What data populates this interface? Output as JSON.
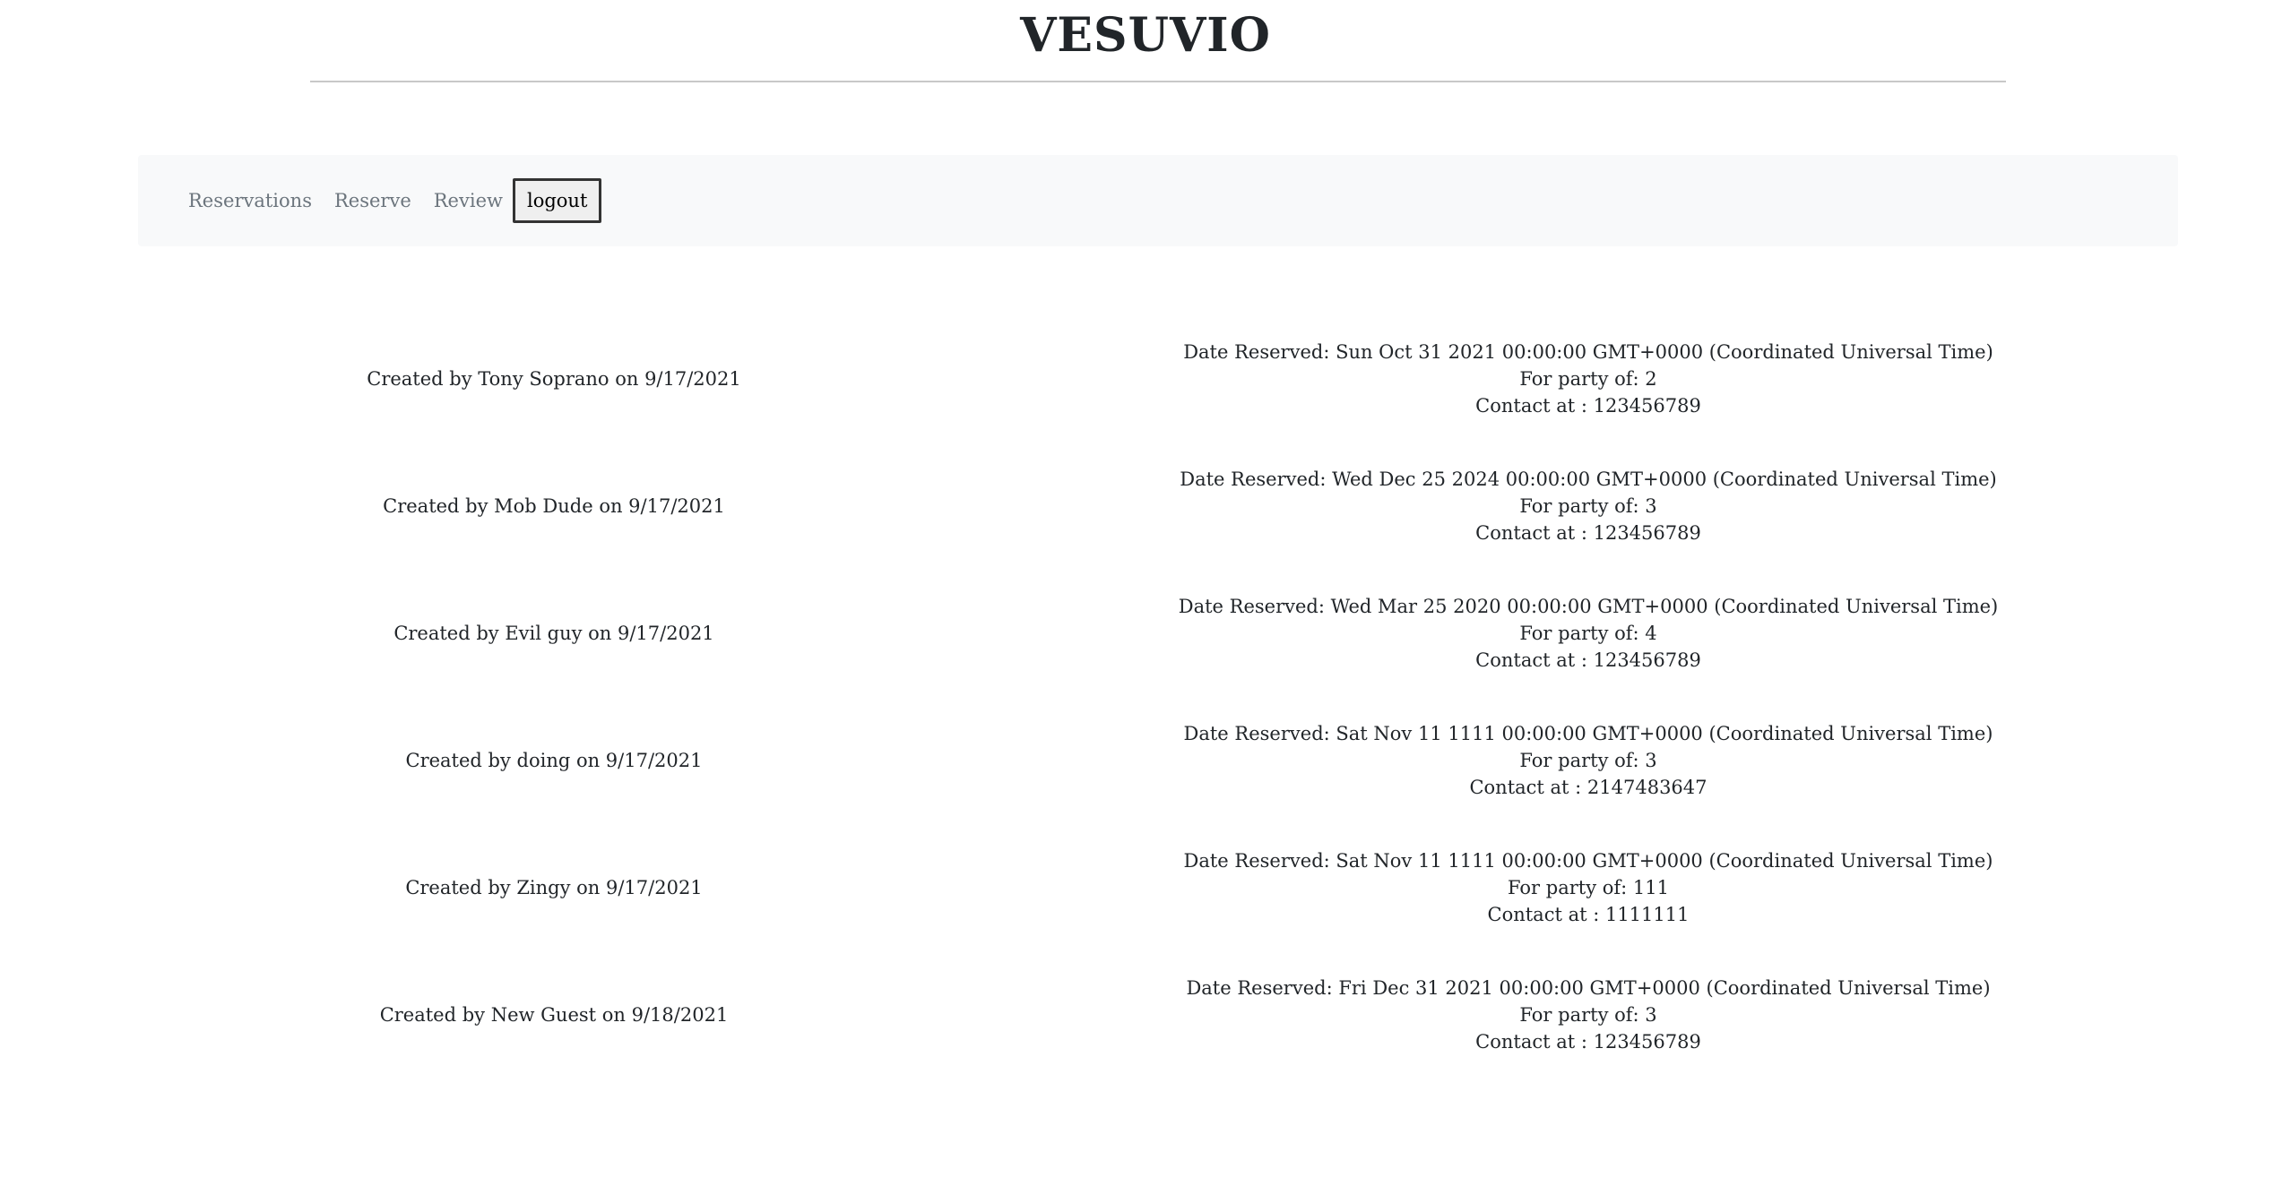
{
  "header": {
    "title": "VESUVIO"
  },
  "nav": {
    "reservations_label": "Reservations",
    "reserve_label": "Reserve",
    "review_label": "Review",
    "logout_label": "logout"
  },
  "reservations": [
    {
      "created": "Created by Tony Soprano on 9/17/2021",
      "date": "Date Reserved: Sun Oct 31 2021 00:00:00 GMT+0000 (Coordinated Universal Time)",
      "party": "For party of: 2",
      "contact": "Contact at : 123456789"
    },
    {
      "created": "Created by Mob Dude on 9/17/2021",
      "date": "Date Reserved: Wed Dec 25 2024 00:00:00 GMT+0000 (Coordinated Universal Time)",
      "party": "For party of: 3",
      "contact": "Contact at : 123456789"
    },
    {
      "created": "Created by Evil guy on 9/17/2021",
      "date": "Date Reserved: Wed Mar 25 2020 00:00:00 GMT+0000 (Coordinated Universal Time)",
      "party": "For party of: 4",
      "contact": "Contact at : 123456789"
    },
    {
      "created": "Created by doing on 9/17/2021",
      "date": "Date Reserved: Sat Nov 11 1111 00:00:00 GMT+0000 (Coordinated Universal Time)",
      "party": "For party of: 3",
      "contact": "Contact at : 2147483647"
    },
    {
      "created": "Created by Zingy on 9/17/2021",
      "date": "Date Reserved: Sat Nov 11 1111 00:00:00 GMT+0000 (Coordinated Universal Time)",
      "party": "For party of: 111",
      "contact": "Contact at : 1111111"
    },
    {
      "created": "Created by New Guest on 9/18/2021",
      "date": "Date Reserved: Fri Dec 31 2021 00:00:00 GMT+0000 (Coordinated Universal Time)",
      "party": "For party of: 3",
      "contact": "Contact at : 123456789"
    }
  ]
}
